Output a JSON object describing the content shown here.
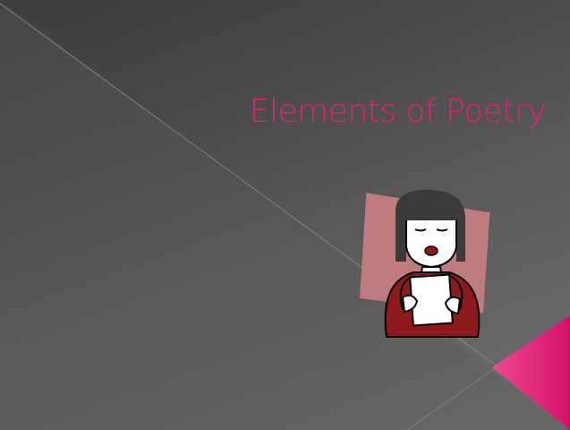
{
  "slide": {
    "title": "Elements of Poetry",
    "accent_color": "#e8207a"
  },
  "illustration": {
    "subject": "girl-reading-poem-clipart"
  }
}
